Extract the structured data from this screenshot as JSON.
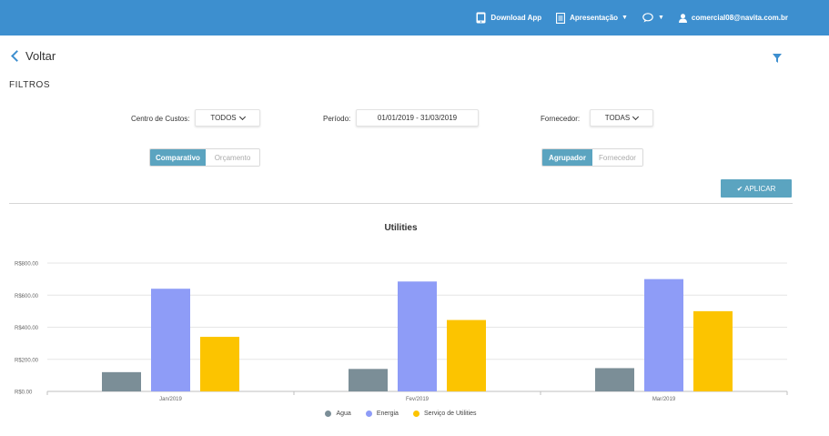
{
  "topbar": {
    "download_label": "Download App",
    "presentation_label": "Apresentação",
    "user_email": "comercial08@navita.com.br"
  },
  "back_label": "Voltar",
  "filters_title": "FILTROS",
  "filters": {
    "cost_center_label": "Centro de Custos:",
    "cost_center_value": "TODOS",
    "period_label": "Período:",
    "period_value": "01/01/2019 - 31/03/2019",
    "supplier_label": "Fornecedor:",
    "supplier_value": "TODAS",
    "view_toggle": {
      "active": "Comparativo",
      "inactive": "Orçamento"
    },
    "group_toggle": {
      "active": "Agrupador",
      "inactive": "Fornecedor"
    },
    "apply_label": "✔ APLICAR"
  },
  "chart_data": {
    "type": "bar",
    "title": "Utilities",
    "categories": [
      "Jan/2019",
      "Fev/2019",
      "Mar/2019"
    ],
    "y_ticks": [
      "R$0.00",
      "R$200.00",
      "R$400.00",
      "R$600.00",
      "R$800.00"
    ],
    "ylim": [
      0,
      800
    ],
    "series": [
      {
        "name": "Agua",
        "color": "#7b8e97",
        "values": [
          120,
          140,
          145
        ]
      },
      {
        "name": "Energia",
        "color": "#8e9cf7",
        "values": [
          640,
          685,
          700
        ]
      },
      {
        "name": "Serviço de Utilities",
        "color": "#fcc400",
        "values": [
          340,
          445,
          500
        ]
      }
    ],
    "legend_position": "bottom",
    "grid": true
  }
}
